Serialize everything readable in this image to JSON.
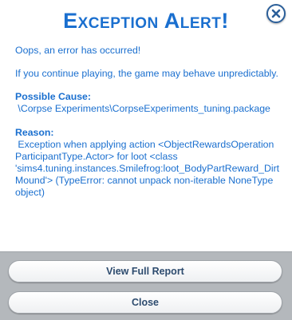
{
  "dialog": {
    "title": "Exception Alert!",
    "intro": "Oops, an error has occurred!",
    "warning": "If you continue playing, the game may behave unpredictably.",
    "possible_cause_heading": "Possible Cause:",
    "possible_cause_text": " \\Corpse Experiments\\CorpseExperiments_tuning.package",
    "reason_heading": "Reason:",
    "reason_text": " Exception when applying action <ObjectRewardsOperation ParticipantType.Actor> for loot <class 'sims4.tuning.instances.Smilefrog:loot_BodyPartReward_DirtMound'> (TypeError: cannot unpack non-iterable NoneType object)"
  },
  "buttons": {
    "view_full_report": "View Full Report",
    "close": "Close"
  },
  "colors": {
    "text": "#1a6fcf",
    "footer": "#b4b8bc",
    "button_text": "#2d4b6e"
  },
  "icons": {
    "close": "close-icon"
  }
}
